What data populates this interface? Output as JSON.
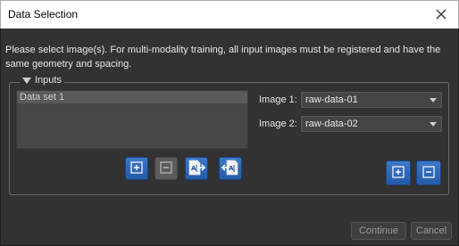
{
  "window": {
    "title": "Data Selection"
  },
  "instructions": "Please select image(s). For multi-modality training, all input images must be registered and have the same geometry and spacing.",
  "inputs_group": {
    "title": "Inputs",
    "datasets": [
      "Data set 1"
    ]
  },
  "images": [
    {
      "label": "Image 1:",
      "value": "raw-data-01"
    },
    {
      "label": "Image 2:",
      "value": "raw-data-02"
    }
  ],
  "footer": {
    "continue_label": "Continue",
    "cancel_label": "Cancel"
  },
  "icons": {
    "dataset_buttons": [
      "plus-icon",
      "minus-icon",
      "import-file-icon",
      "export-file-icon"
    ],
    "image_buttons": [
      "plus-icon",
      "minus-icon"
    ],
    "close": "close-icon"
  },
  "colors": {
    "button_blue": "#2f6bbf",
    "panel_bg": "#323232",
    "list_bg": "#474747"
  }
}
